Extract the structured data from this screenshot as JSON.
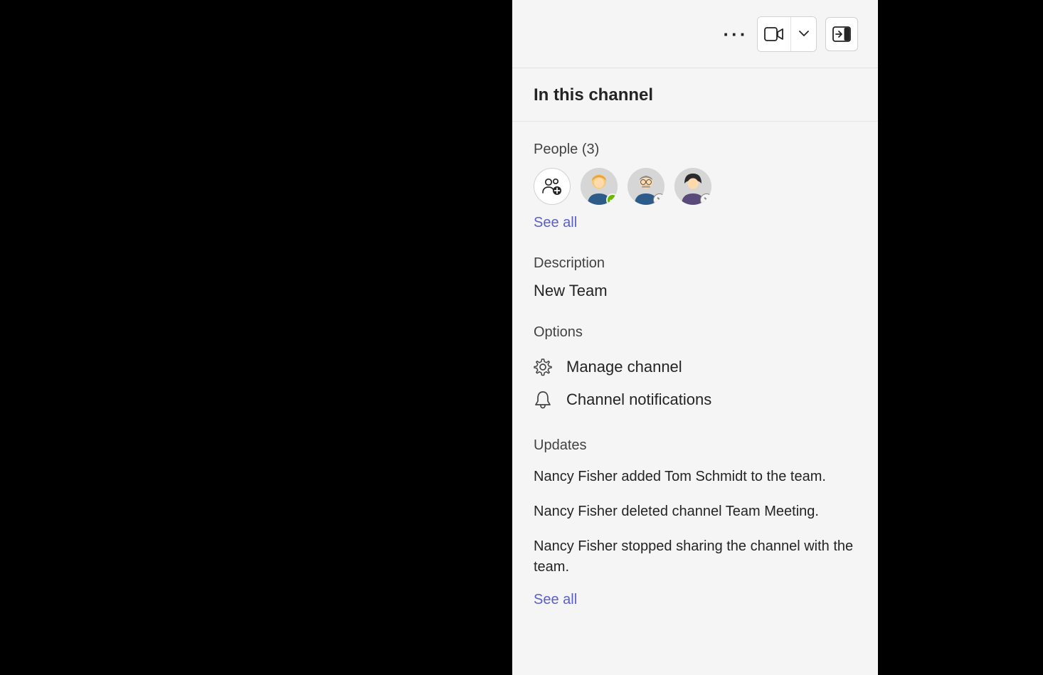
{
  "header": {
    "title": "In this channel"
  },
  "people": {
    "label": "People (3)",
    "seeAll": "See all",
    "members": [
      {
        "name": "member-1",
        "presence": "available"
      },
      {
        "name": "member-2",
        "presence": "offline"
      },
      {
        "name": "member-3",
        "presence": "offline"
      }
    ]
  },
  "description": {
    "label": "Description",
    "value": "New Team"
  },
  "options": {
    "label": "Options",
    "items": [
      {
        "icon": "gear",
        "label": "Manage channel"
      },
      {
        "icon": "bell",
        "label": "Channel notifications"
      }
    ]
  },
  "updates": {
    "label": "Updates",
    "items": [
      "Nancy Fisher added Tom Schmidt to the team.",
      "Nancy Fisher deleted channel Team Meeting.",
      "Nancy Fisher stopped sharing the channel with the team."
    ],
    "seeAll": "See all"
  }
}
